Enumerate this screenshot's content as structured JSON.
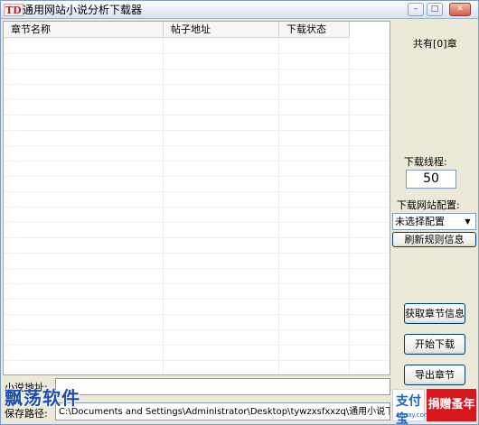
{
  "window": {
    "title": "通用网站小说分析下载器",
    "logo_text": "TD"
  },
  "table": {
    "columns": [
      "章节名称",
      "帖子地址",
      "下载状态"
    ],
    "rows": []
  },
  "side_panel": {
    "chapter_count": "共有[0]章",
    "threads_label": "下载线程:",
    "threads_value": "50",
    "site_config_label": "下载网站配置:",
    "site_config_selected": "未选择配置",
    "refresh_rules_button": "刷新规则信息",
    "fetch_chapters_button": "获取章节信息",
    "start_download_button": "开始下载",
    "export_chapters_button": "导出章节"
  },
  "form": {
    "novel_url_label": "小说地址:",
    "novel_url_value": "",
    "save_path_label": "保存路径:",
    "save_path_value": "C:\\Documents and Settings\\Administrator\\Desktop\\tywzxsfxxzq\\通用小说下载器\\Downl"
  },
  "watermark": {
    "text": "飘荡软件"
  },
  "badges": {
    "alipay_main": "支付宝",
    "alipay_sub": "Alipay.com",
    "donate_label": "捐赠蚤年"
  }
}
